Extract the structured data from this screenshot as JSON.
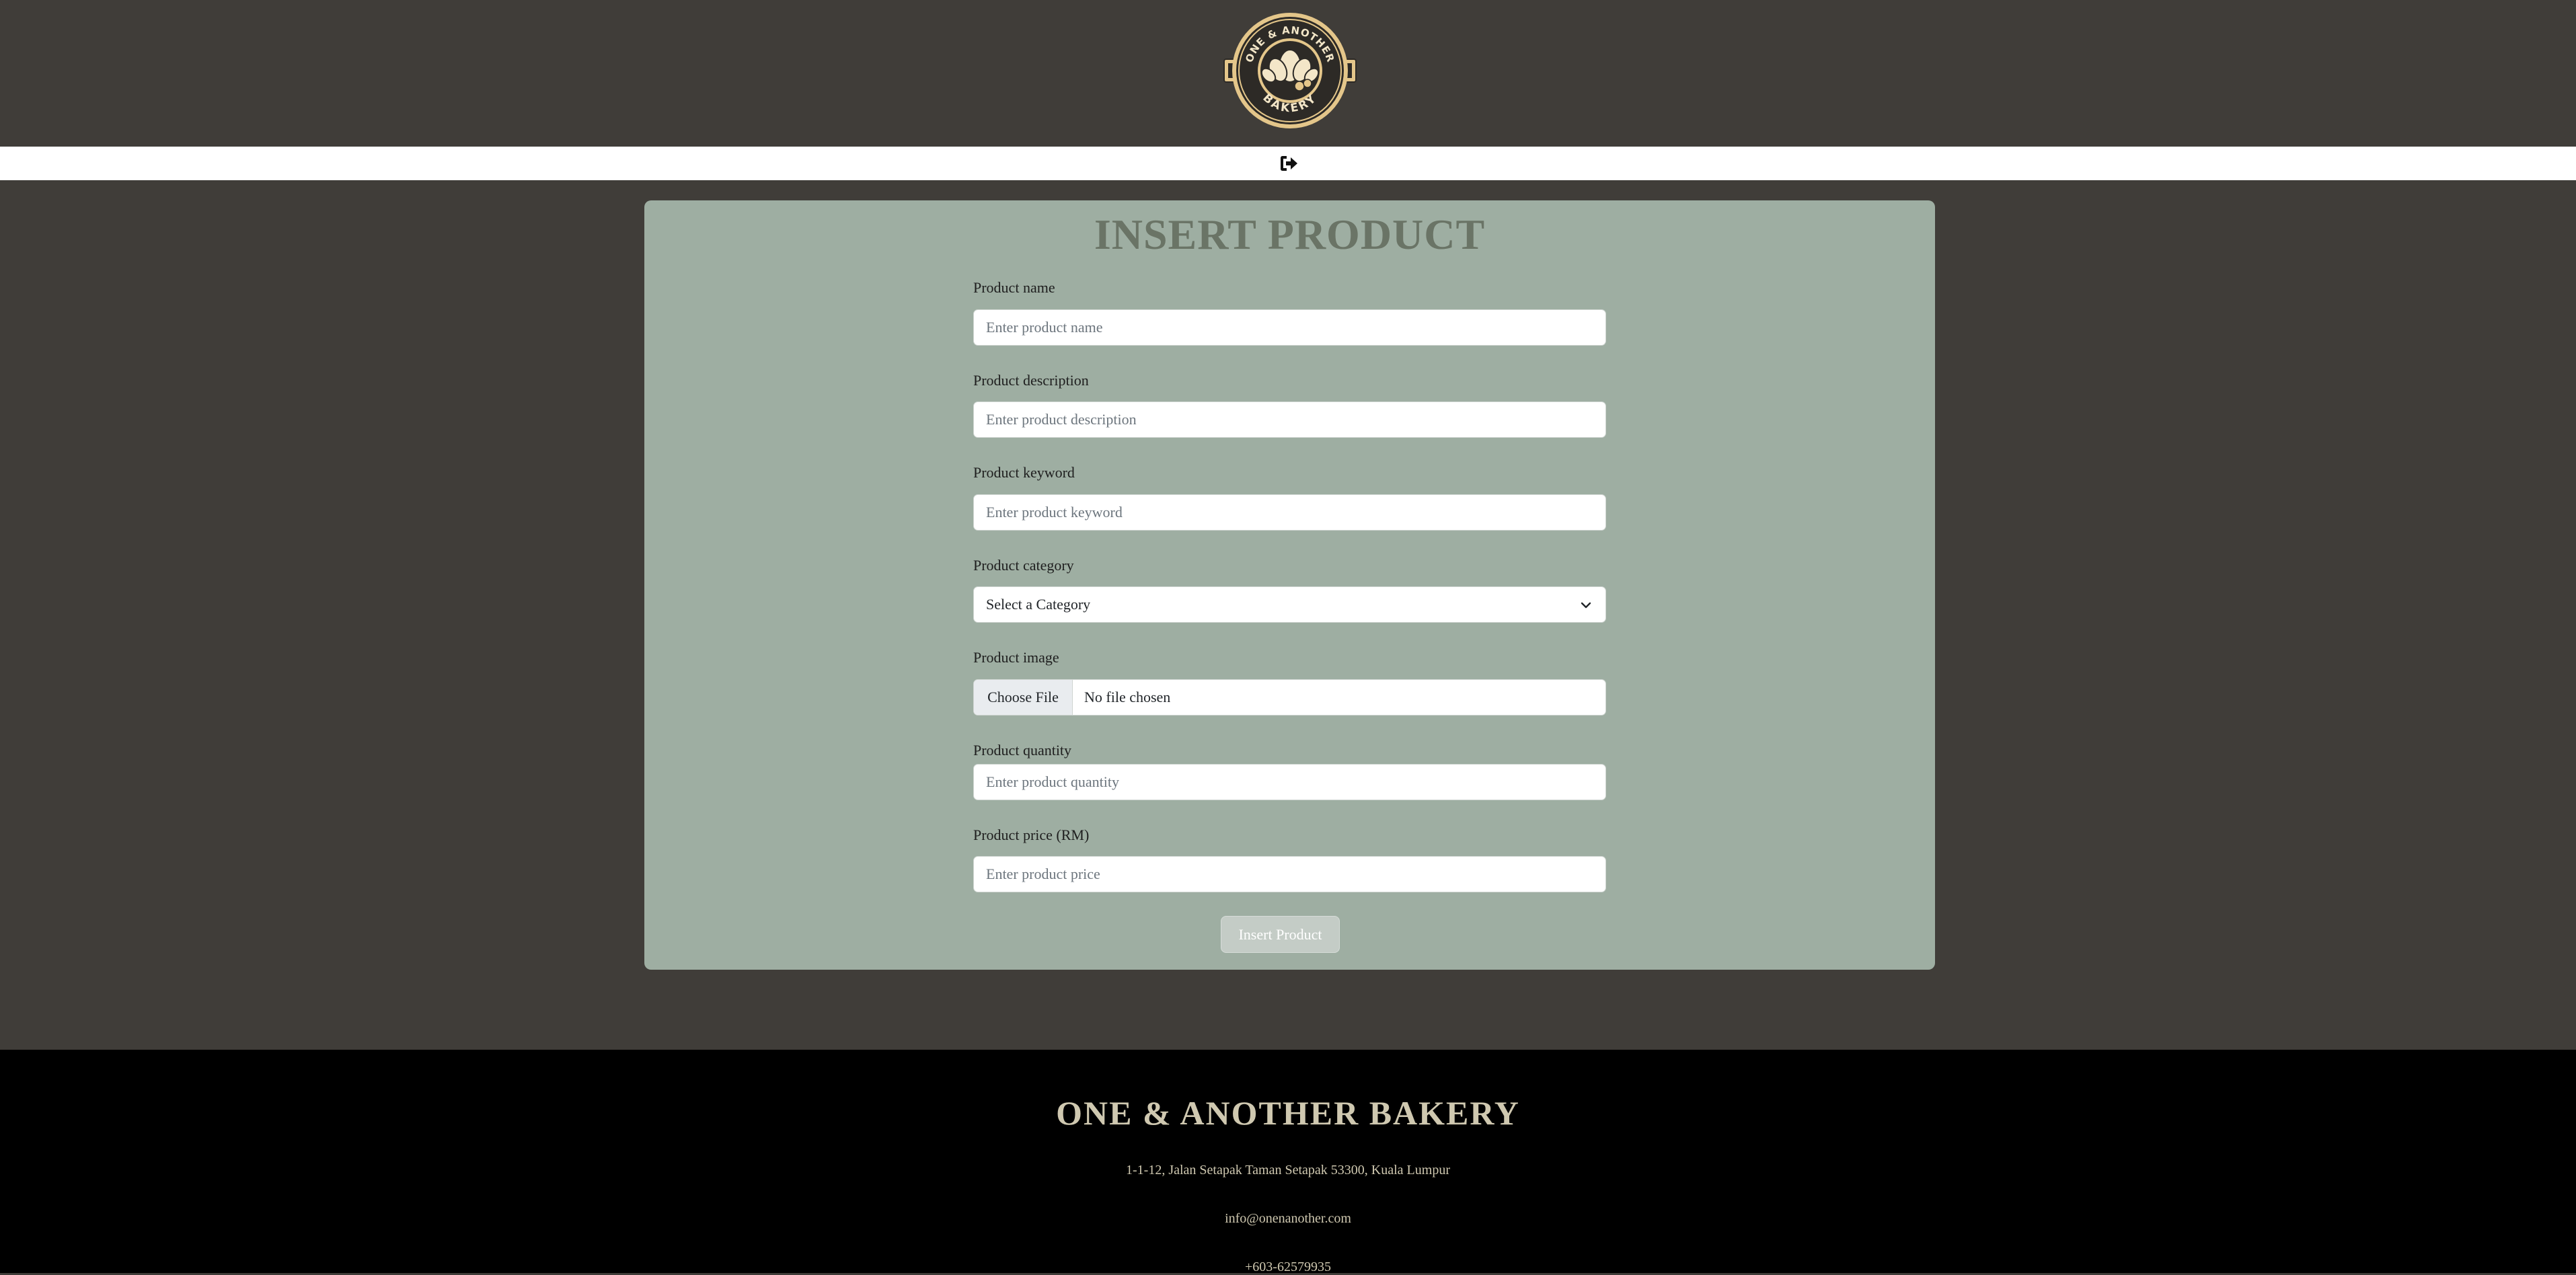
{
  "header": {
    "logo": {
      "icon": "bakery-logo-icon",
      "text_top": "ONE & ANOTHER",
      "text_bottom": "BAKERY",
      "colors": {
        "gold": "#e4c68a",
        "dark": "#2d2a26",
        "cream": "#f3e6c8"
      }
    },
    "nav": {
      "logout_icon": "logout-icon"
    }
  },
  "form": {
    "title": "INSERT PRODUCT",
    "fields": {
      "name": {
        "label": "Product name",
        "placeholder": "Enter product name",
        "value": ""
      },
      "description": {
        "label": "Product description",
        "placeholder": "Enter product description",
        "value": ""
      },
      "keyword": {
        "label": "Product keyword",
        "placeholder": "Enter product keyword",
        "value": ""
      },
      "category": {
        "label": "Product category",
        "selected": "Select a Category"
      },
      "image": {
        "label": "Product image",
        "button_label": "Choose File",
        "status": "No file chosen"
      },
      "quantity": {
        "label": "Product quantity",
        "placeholder": "Enter product quantity",
        "value": ""
      },
      "price": {
        "label": "Product price (RM)",
        "placeholder": "Enter product price",
        "value": ""
      }
    },
    "submit_label": "Insert Product"
  },
  "footer": {
    "brand": "ONE & ANOTHER BAKERY",
    "address": "1-1-12, Jalan Setapak Taman Setapak 53300, Kuala Lumpur",
    "email": "info@onenanother.com",
    "phone": "+603-62579935"
  },
  "colors": {
    "page_bg": "#403d39",
    "card_bg": "#9eaea2",
    "title": "#6a7466",
    "footer_bg": "#000000",
    "footer_text": "#cfc8b0"
  }
}
